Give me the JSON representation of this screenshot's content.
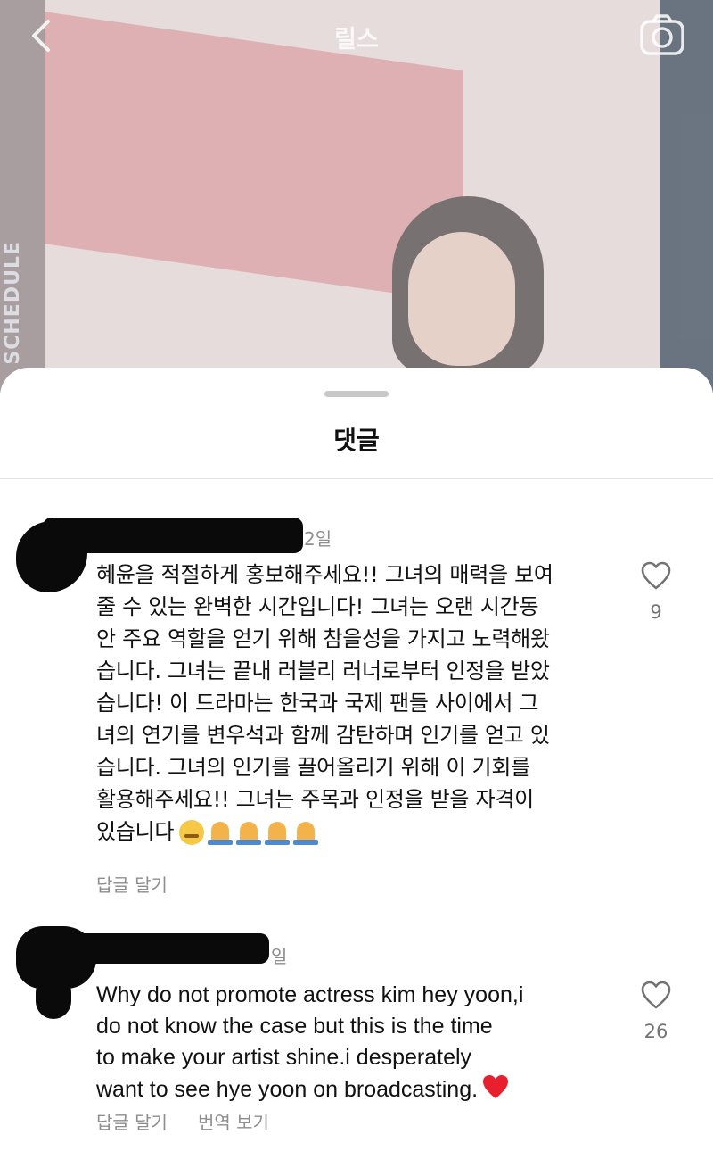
{
  "reel": {
    "title": "릴스",
    "side_text": "SCHEDULE"
  },
  "icons": {
    "back": "chevron-left-icon",
    "camera": "camera-icon",
    "like": "heart-outline-icon"
  },
  "sheet": {
    "title": "댓글"
  },
  "comments": [
    {
      "time": "2일",
      "text_lines": [
        "혜윤을 적절하게 홍보해주세요!! 그녀의 매력을 보여",
        "줄 수 있는 완벽한 시간입니다! 그녀는 오랜 시간동",
        "안 주요 역할을 얻기 위해 참을성을 가지고 노력해왔",
        "습니다. 그녀는 끝내 러블리 러너로부터 인정을 받았",
        "습니다! 이 드라마는 한국과 국제 팬들 사이에서 그",
        "녀의 연기를 변우석과 함께 감탄하며 인기를 얻고 있",
        "습니다. 그녀의 인기를 끌어올리기 위해 이 기회를",
        "활용해주세요!! 그녀는 주목과 인정을 받을 자격이"
      ],
      "last_line": "있습니다",
      "likes": "9",
      "reply_label": "답글 달기"
    },
    {
      "time": "일",
      "text_lines": [
        "Why do not promote actress kim hey yoon,i",
        "do not know the case but this is the time",
        "to make your artist shine.i desperately"
      ],
      "last_line": "want to see hye yoon on broadcasting.",
      "likes": "26",
      "reply_label": "답글 달기",
      "translate_label": "번역 보기"
    }
  ]
}
